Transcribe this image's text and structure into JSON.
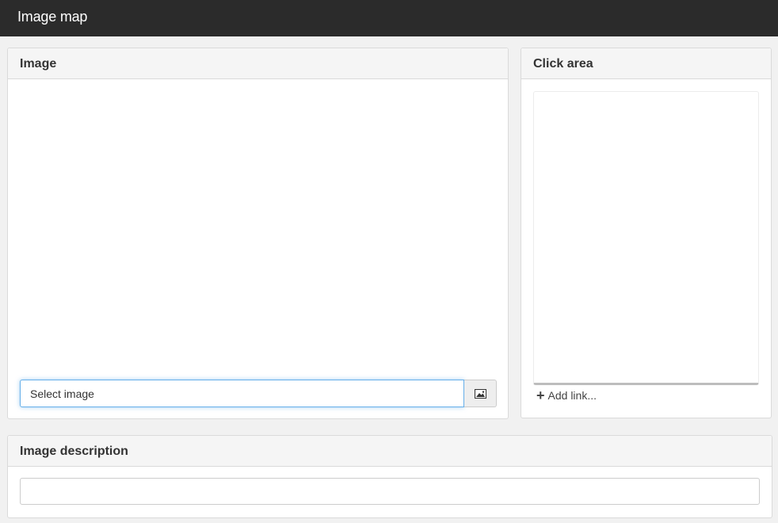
{
  "app": {
    "title": "Image map"
  },
  "image_panel": {
    "heading": "Image",
    "select_input_value": "Select image",
    "select_button_icon": "image-icon"
  },
  "click_area_panel": {
    "heading": "Click area",
    "add_link_icon": "plus-icon",
    "add_link_label": "Add link..."
  },
  "description_panel": {
    "heading": "Image description",
    "input_value": ""
  },
  "colors": {
    "topbar": "#2b2b2b",
    "focus_border": "#66afe9"
  }
}
